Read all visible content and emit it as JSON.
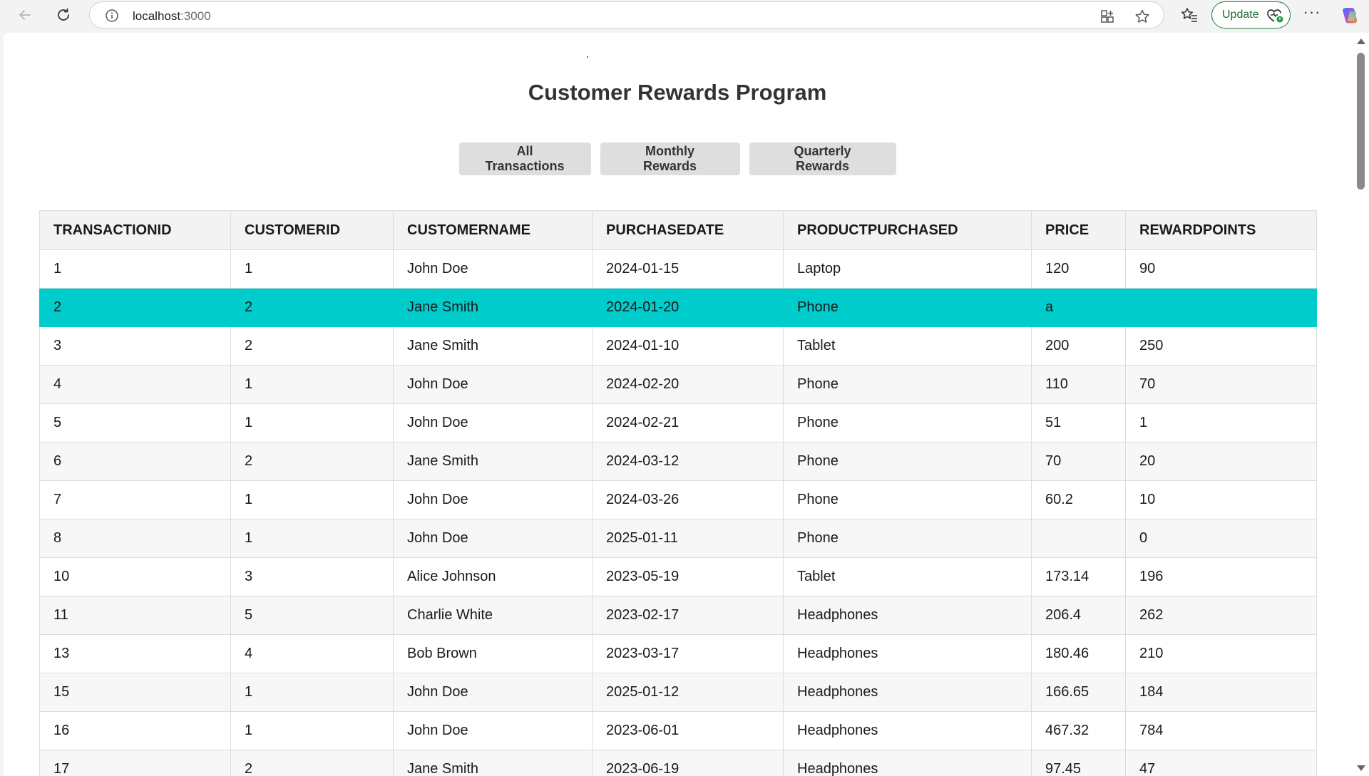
{
  "browser": {
    "url_host": "localhost",
    "url_port": ":3000",
    "update_label": "Update",
    "more_label": "···"
  },
  "page": {
    "title": "Customer Rewards Program",
    "tabs": [
      "All Transactions",
      "Monthly Rewards",
      "Quarterly Rewards"
    ]
  },
  "table": {
    "columns": [
      "TRANSACTIONID",
      "CUSTOMERID",
      "CUSTOMERNAME",
      "PURCHASEDATE",
      "PRODUCTPURCHASED",
      "PRICE",
      "REWARDPOINTS"
    ],
    "selected_row": 1,
    "rows": [
      [
        "1",
        "1",
        "John Doe",
        "2024-01-15",
        "Laptop",
        "120",
        "90"
      ],
      [
        "2",
        "2",
        "Jane Smith",
        "2024-01-20",
        "Phone",
        "a",
        ""
      ],
      [
        "3",
        "2",
        "Jane Smith",
        "2024-01-10",
        "Tablet",
        "200",
        "250"
      ],
      [
        "4",
        "1",
        "John Doe",
        "2024-02-20",
        "Phone",
        "110",
        "70"
      ],
      [
        "5",
        "1",
        "John Doe",
        "2024-02-21",
        "Phone",
        "51",
        "1"
      ],
      [
        "6",
        "2",
        "Jane Smith",
        "2024-03-12",
        "Phone",
        "70",
        "20"
      ],
      [
        "7",
        "1",
        "John Doe",
        "2024-03-26",
        "Phone",
        "60.2",
        "10"
      ],
      [
        "8",
        "1",
        "John Doe",
        "2025-01-11",
        "Phone",
        "",
        "0"
      ],
      [
        "10",
        "3",
        "Alice Johnson",
        "2023-05-19",
        "Tablet",
        "173.14",
        "196"
      ],
      [
        "11",
        "5",
        "Charlie White",
        "2023-02-17",
        "Headphones",
        "206.4",
        "262"
      ],
      [
        "13",
        "4",
        "Bob Brown",
        "2023-03-17",
        "Headphones",
        "180.46",
        "210"
      ],
      [
        "15",
        "1",
        "John Doe",
        "2025-01-12",
        "Headphones",
        "166.65",
        "184"
      ],
      [
        "16",
        "1",
        "John Doe",
        "2023-06-01",
        "Headphones",
        "467.32",
        "784"
      ],
      [
        "17",
        "2",
        "Jane Smith",
        "2023-06-19",
        "Headphones",
        "97.45",
        "47"
      ]
    ]
  },
  "colors": {
    "selected_row": "#00cccc",
    "header_bg": "#f3f3f3",
    "tab_bg": "#dedede",
    "update_border": "#1f7a3a"
  }
}
